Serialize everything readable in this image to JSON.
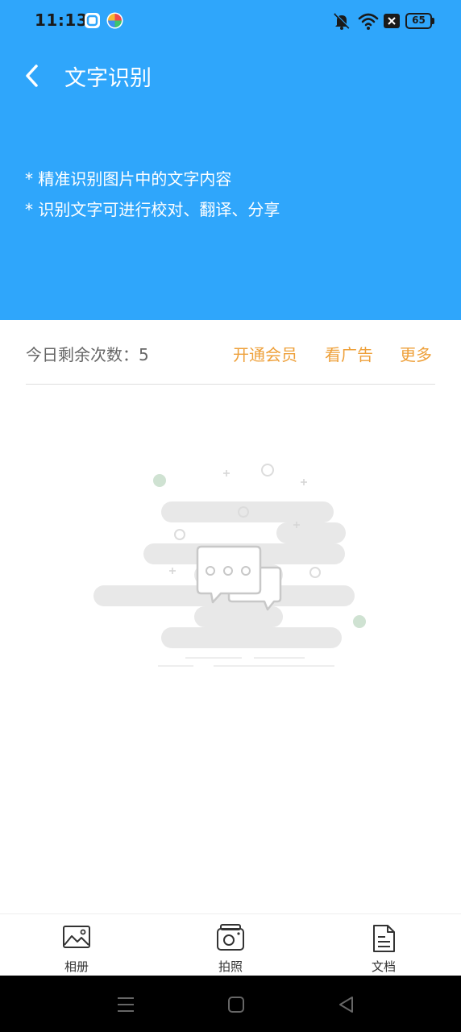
{
  "status_bar": {
    "time": "11:13",
    "battery": "65",
    "icons": [
      "app-square-icon",
      "pinwheel-app-icon",
      "mute-icon",
      "wifi-icon",
      "close-box-icon",
      "battery-icon"
    ]
  },
  "header": {
    "title": "文字识别",
    "descriptions": [
      "* 精准识别图片中的文字内容",
      "* 识别文字可进行校对、翻译、分享"
    ],
    "background": "#2fa6fb"
  },
  "usage": {
    "label": "今日剩余次数：",
    "count": "5",
    "links": {
      "vip": "开通会员",
      "ad": "看广告",
      "more": "更多"
    },
    "link_color": "#eea03a"
  },
  "empty_state": {
    "icon": "empty-chat-illustration"
  },
  "bottom_tabs": [
    {
      "label": "相册",
      "icon": "image-icon"
    },
    {
      "label": "拍照",
      "icon": "camera-icon"
    },
    {
      "label": "文档",
      "icon": "document-icon"
    }
  ],
  "nav_bar": {
    "icons": [
      "menu-icon",
      "home-icon",
      "back-triangle-icon"
    ]
  }
}
